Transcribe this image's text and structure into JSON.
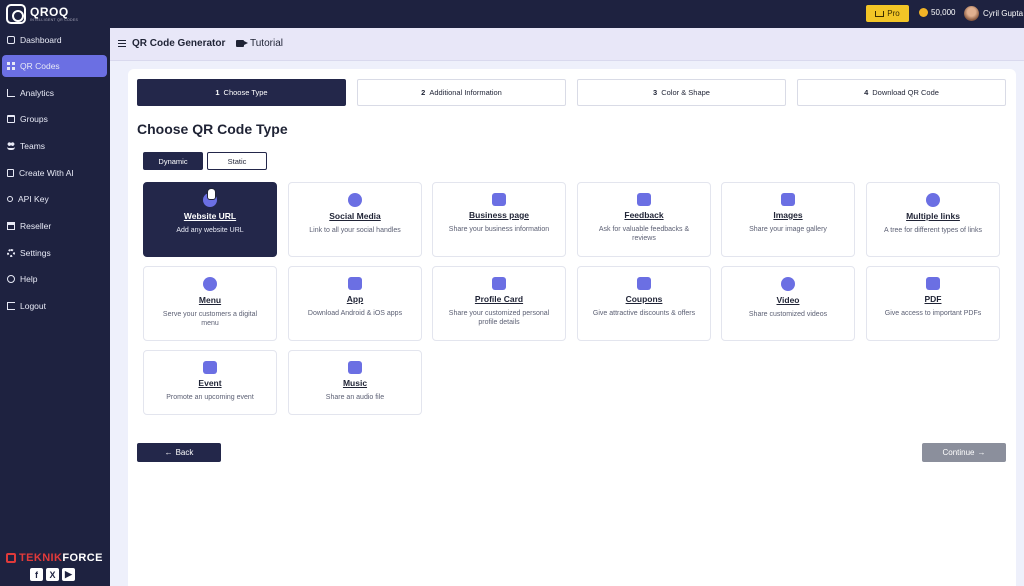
{
  "topbar": {
    "logo_name": "QROQ",
    "logo_sub": "INTELLIGENT QR CODES",
    "pro_label": "Pro",
    "credits": "50,000",
    "user_name": "Cyril Gupta"
  },
  "sidebar": {
    "items": [
      {
        "label": "Dashboard",
        "icon": "dashboard-icon"
      },
      {
        "label": "QR Codes",
        "icon": "grid-icon"
      },
      {
        "label": "Analytics",
        "icon": "chart-icon"
      },
      {
        "label": "Groups",
        "icon": "folder-icon"
      },
      {
        "label": "Teams",
        "icon": "people-icon"
      },
      {
        "label": "Create With AI",
        "icon": "document-icon"
      },
      {
        "label": "API Key",
        "icon": "key-icon"
      },
      {
        "label": "Reseller",
        "icon": "store-icon"
      },
      {
        "label": "Settings",
        "icon": "gear-icon"
      },
      {
        "label": "Help",
        "icon": "help-icon"
      },
      {
        "label": "Logout",
        "icon": "logout-icon"
      }
    ],
    "active_index": 1,
    "brand_left": "TEKNIK",
    "brand_right": "FORCE",
    "social": [
      "f",
      "X",
      "▶"
    ]
  },
  "header": {
    "title": "QR Code Generator",
    "tutorial": "Tutorial"
  },
  "steps": [
    {
      "num": "1",
      "label": "Choose Type"
    },
    {
      "num": "2",
      "label": "Additional Information"
    },
    {
      "num": "3",
      "label": "Color & Shape"
    },
    {
      "num": "4",
      "label": "Download QR Code"
    }
  ],
  "section_title": "Choose QR Code Type",
  "toggles": {
    "dynamic": "Dynamic",
    "static": "Static"
  },
  "tiles": [
    {
      "title": "Website URL",
      "desc": "Add any website URL",
      "icon": "globe-icon"
    },
    {
      "title": "Social Media",
      "desc": "Link to all your social handles",
      "icon": "share-icon"
    },
    {
      "title": "Business page",
      "desc": "Share your business information",
      "icon": "briefcase-icon"
    },
    {
      "title": "Feedback",
      "desc": "Ask for valuable feedbacks & reviews",
      "icon": "feedback-icon"
    },
    {
      "title": "Images",
      "desc": "Share your image gallery",
      "icon": "image-icon"
    },
    {
      "title": "Multiple links",
      "desc": "A tree for different types of links",
      "icon": "link-icon"
    },
    {
      "title": "Menu",
      "desc": "Serve your customers a digital menu",
      "icon": "menu-icon"
    },
    {
      "title": "App",
      "desc": "Download Android & iOS apps",
      "icon": "phone-icon"
    },
    {
      "title": "Profile Card",
      "desc": "Share your customized personal profile details",
      "icon": "profile-card-icon"
    },
    {
      "title": "Coupons",
      "desc": "Give attractive discounts & offers",
      "icon": "coupon-icon"
    },
    {
      "title": "Video",
      "desc": "Share customized videos",
      "icon": "play-icon"
    },
    {
      "title": "PDF",
      "desc": "Give access to important PDFs",
      "icon": "pdf-icon"
    },
    {
      "title": "Event",
      "desc": "Promote an upcoming event",
      "icon": "calendar-icon"
    },
    {
      "title": "Music",
      "desc": "Share an audio file",
      "icon": "music-icon"
    }
  ],
  "buttons": {
    "back": "Back",
    "continue": "Continue"
  },
  "colors": {
    "sidebar": "#1e2240",
    "accent": "#6b6fe3",
    "pro": "#f2c526",
    "selected": "#23274a"
  }
}
